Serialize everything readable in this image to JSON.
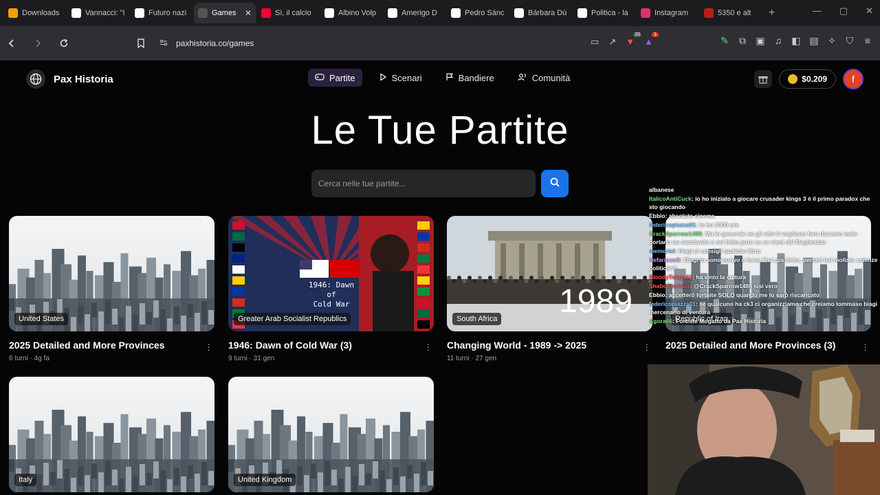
{
  "browser": {
    "tabs": [
      {
        "title": "Downloads",
        "icon_color": "#f59e0b"
      },
      {
        "title": "Vannacci: \"I",
        "icon_color": "#ffffff"
      },
      {
        "title": "Futuro nazi",
        "icon_color": "#ffffff"
      },
      {
        "title": "Games",
        "icon_color": "#555555",
        "active": true
      },
      {
        "title": "Sì, il calcio",
        "icon_color": "#ff0033"
      },
      {
        "title": "Albino Volp",
        "icon_color": "#ffffff"
      },
      {
        "title": "Amerigo D",
        "icon_color": "#ffffff"
      },
      {
        "title": "Pedro Sánc",
        "icon_color": "#ffffff"
      },
      {
        "title": "Bárbara Dú",
        "icon_color": "#ffffff"
      },
      {
        "title": "Politica - la",
        "icon_color": "#ffffff"
      },
      {
        "title": "Instagram",
        "icon_color": "#e1306c"
      },
      {
        "title": "5350 e alt",
        "icon_color": "#b91c1c"
      }
    ],
    "url": "paxhistoria.co/games",
    "brave_badge": "20",
    "alert_badge": "1"
  },
  "site": {
    "brand": "Pax Historia",
    "nav": [
      {
        "label": "Partite",
        "icon": "gamepad-icon",
        "active": true
      },
      {
        "label": "Scenari",
        "icon": "play-icon"
      },
      {
        "label": "Bandiere",
        "icon": "flag-icon"
      },
      {
        "label": "Comunità",
        "icon": "users-icon"
      }
    ],
    "balance": "$0.209",
    "avatar_letter": "f",
    "page_title": "Le Tue Partite",
    "search_placeholder": "Cerca nelle tue partite...",
    "accent": "#1a73e8"
  },
  "games": [
    {
      "nation": "United States",
      "title": "2025 Detailed and More Provinces",
      "meta": "6 turni · 4g fa",
      "image": "city"
    },
    {
      "nation": "Greater Arab Socialist Republics",
      "title": "1946: Dawn of Cold War (3)",
      "meta": "9 turni · 31 gen",
      "image": "coldwar",
      "image_text": [
        "1946: Dawn",
        "of",
        "Cold War"
      ]
    },
    {
      "nation": "South Africa",
      "title": "Changing World - 1989 -> 2025",
      "meta": "11 turni · 27 gen",
      "image": "berlin",
      "image_text": [
        "1989"
      ]
    },
    {
      "nation": "Republic of Iran",
      "title": "2025 Detailed and More Provinces (3)",
      "meta": "",
      "image": "city"
    },
    {
      "nation": "Italy",
      "title": "",
      "meta": "",
      "image": "city"
    },
    {
      "nation": "United Kingdom",
      "title": "",
      "meta": "",
      "image": "city"
    }
  ],
  "chat": [
    {
      "user": "",
      "text": "albanese",
      "color": "#ffffff"
    },
    {
      "user": "ItalicoAntiCuck",
      "text": ": io ho iniziato a giocare crusader kings 3 è il primo paradox che sto giocando",
      "color": "#7ee081"
    },
    {
      "user": "Ebbio",
      "text": ": absolute cinema",
      "color": "#ffffff"
    },
    {
      "user": "federicopiazza01",
      "text": ": io ho 3000 ore",
      "color": "#7ec8ff"
    },
    {
      "user": "CrackSparrow1488",
      "text": ": Ma in generale se gli altri ti vogliono fare davvero male portano un cacciavite e sei fritto pure se se vieni dal Daghestan",
      "color": "#7ee081"
    },
    {
      "user": "memoriel",
      "text": ": biagi ci consigli qualche libro",
      "color": "#7ec8ff"
    },
    {
      "user": "NefariousG",
      "text": ": Biagi io sono nuovo e forse l'hai già detto, perché hai mollato scienze politiche?",
      "color": "#e0a0ff"
    },
    {
      "user": "BloodyTengu02",
      "text": ": ha vinto la cultura",
      "color": "#ff5a5a"
    },
    {
      "user": "ShaboElurious",
      "text": ": @CrackSparrow1488 sisi vero",
      "color": "#ff5a5a"
    },
    {
      "user": "Ebbio",
      "text": ": accetterò fortnite SOLO quando me lo sarò riscaricato",
      "color": "#ffffff"
    },
    {
      "user": "federicopiazza01",
      "text": ": se qualcuno ha ck3 ci organizziamo che creiamo tommaso biagi mercenario di ventura",
      "color": "#7ec8ff"
    },
    {
      "user": "Agora66",
      "text": ": Fortnite Mogatto da Pax Historia",
      "color": "#7ee081"
    }
  ]
}
